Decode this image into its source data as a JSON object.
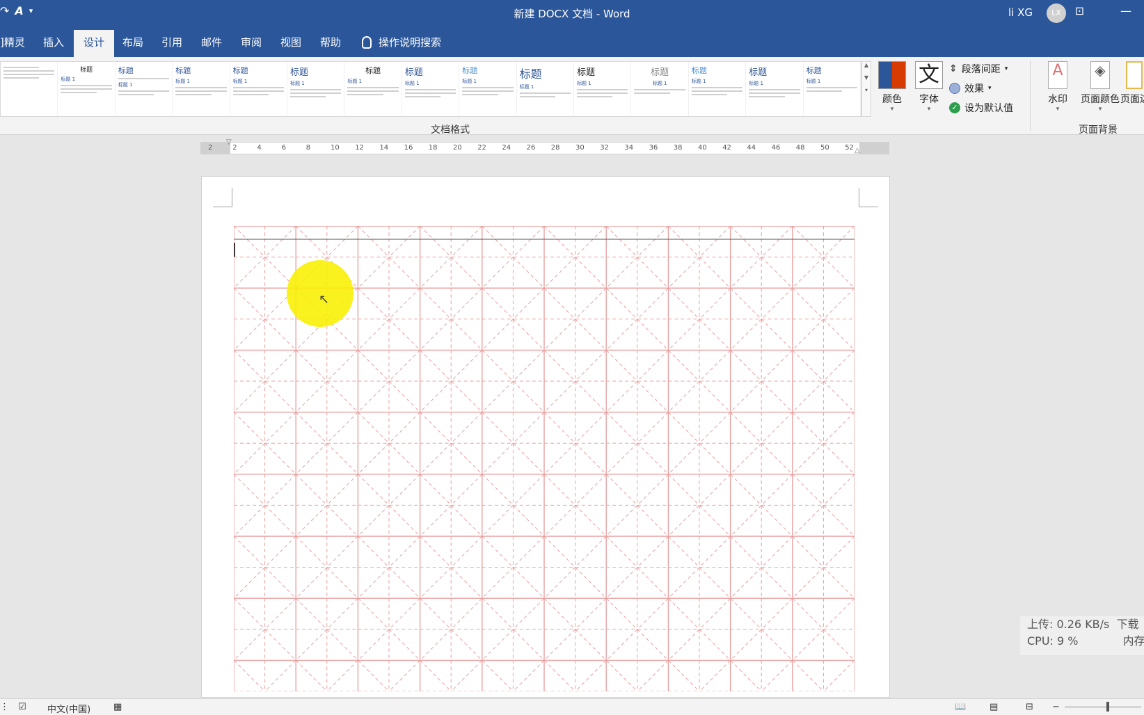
{
  "window": {
    "title": "新建 DOCX 文档  -  Word",
    "user_name": "li XG",
    "avatar_initials": "LX",
    "accent_color": "#2b579a"
  },
  "quick_access": {
    "font_icon_label": "A"
  },
  "tabs": [
    {
      "label": "]精灵"
    },
    {
      "label": "插入"
    },
    {
      "label": "设计"
    },
    {
      "label": "布局"
    },
    {
      "label": "引用"
    },
    {
      "label": "邮件"
    },
    {
      "label": "审阅"
    },
    {
      "label": "视图"
    },
    {
      "label": "帮助"
    }
  ],
  "active_tab": "设计",
  "tell_me": "操作说明搜索",
  "ribbon": {
    "style_gallery": {
      "heading_samples": [
        "标题",
        "标题",
        "标题",
        "标题",
        "标题",
        "标题",
        "标题",
        "标题",
        "标题",
        "标题",
        "标题",
        "标题",
        "标题",
        "标题"
      ],
      "sub_sample": "标题 1"
    },
    "doc_format_label": "文档格式",
    "colors_label": "颜色",
    "fonts_label": "字体",
    "fonts_glyph": "文",
    "paragraph_spacing_label": "段落间距",
    "effects_label": "效果",
    "set_default_label": "设为默认值",
    "watermark_label": "水印",
    "page_color_label": "页面颜色",
    "page_border_label": "页面边",
    "page_background_label": "页面背景"
  },
  "ruler_ticks": [
    "2",
    "2",
    "4",
    "6",
    "8",
    "10",
    "12",
    "14",
    "16",
    "18",
    "20",
    "22",
    "24",
    "26",
    "28",
    "30",
    "32",
    "34",
    "36",
    "38",
    "40",
    "42",
    "44",
    "46",
    "48",
    "50",
    "52"
  ],
  "grid": {
    "type": "米字格",
    "line_color": "#e8a0a0",
    "columns": 10,
    "rows": 8
  },
  "netstat": {
    "upload": "上传: 0.26 KB/s",
    "download": "下载",
    "cpu": "CPU: 9 %",
    "memory": "内存"
  },
  "statusbar": {
    "language": "中文(中国)"
  }
}
